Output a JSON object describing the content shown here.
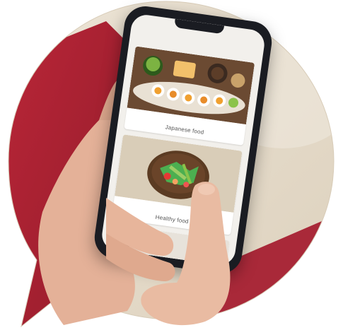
{
  "cards": [
    {
      "label": "Japanese food",
      "icon": "sushi-photo"
    },
    {
      "label": "Healthy food",
      "icon": "salad-bowl-photo"
    },
    {
      "label": "",
      "icon": "sushi-rolls-photo"
    }
  ],
  "colors": {
    "bubble_beige": "#e6dccb",
    "background_red": "#a3162a",
    "phone_body": "#1a1c22",
    "screen_bg": "#f2f0ec",
    "skin": "#e8b9a0"
  }
}
